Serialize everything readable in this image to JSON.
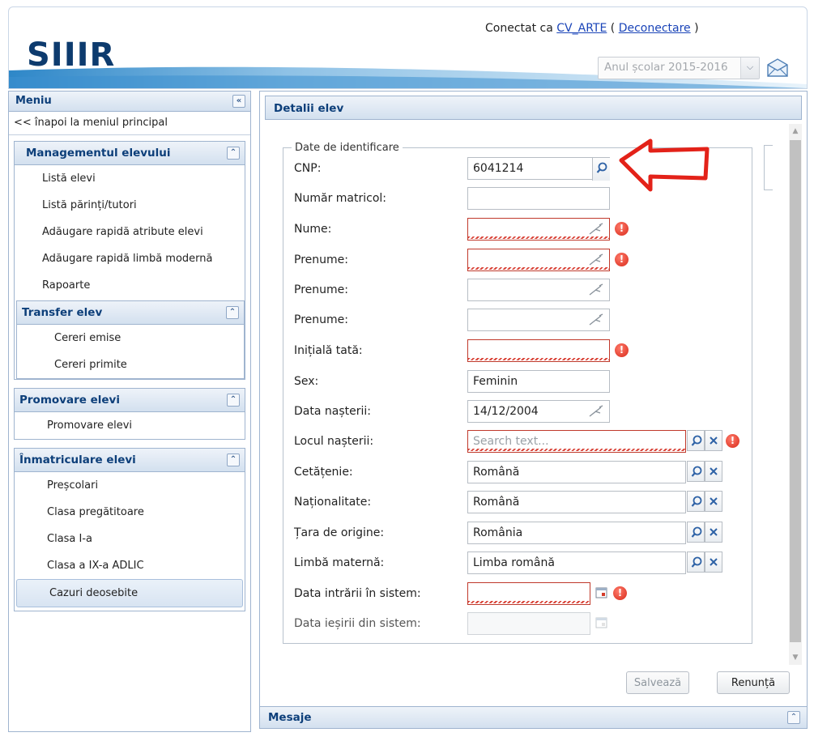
{
  "header": {
    "logo": "SIIIR",
    "connected_prefix": "Conectat ca ",
    "username": "CV_ARTE",
    "paren_open": " ( ",
    "logout": "Deconectare",
    "paren_close": " )",
    "school_year": "Anul școlar 2015-2016"
  },
  "menu": {
    "title": "Meniu",
    "back_link": "<< înapoi la meniul principal",
    "group_title": "Managementul elevului",
    "items": [
      "Listă elevi",
      "Listă părinți/tutori",
      "Adăugare rapidă atribute elevi",
      "Adăugare rapidă limbă modernă",
      "Rapoarte"
    ],
    "transfer": {
      "title": "Transfer elev",
      "items": [
        "Cereri emise",
        "Cereri primite"
      ]
    },
    "promovare": {
      "title": "Promovare elevi",
      "items": [
        "Promovare elevi"
      ]
    },
    "inmatriculare": {
      "title": "Înmatriculare elevi",
      "items": [
        "Preșcolari",
        "Clasa pregătitoare",
        "Clasa I-a",
        "Clasa a IX-a ADLIC",
        "Cazuri deosebite"
      ]
    }
  },
  "main": {
    "title": "Detalii elev",
    "fieldset_legend": "Date de identificare",
    "labels": {
      "cnp": "CNP:",
      "nr_matricol": "Număr matricol:",
      "nume": "Nume:",
      "prenume1": "Prenume:",
      "prenume2": "Prenume:",
      "prenume3": "Prenume:",
      "initiala": "Inițială tată:",
      "sex": "Sex:",
      "data_nasterii": "Data nașterii:",
      "locul_nasterii": "Locul nașterii:",
      "cetatenie": "Cetățenie:",
      "nationalitate": "Naționalitate:",
      "tara": "Țara de origine:",
      "limba": "Limbă maternă:",
      "data_intrarii": "Data intrării în sistem:",
      "data_iesirii": "Data ieșirii din sistem:"
    },
    "values": {
      "cnp": "6041214",
      "sex": "Feminin",
      "data_nasterii": "14/12/2004",
      "locul_nasterii_placeholder": "Search text...",
      "cetatenie": "Română",
      "nationalitate": "Română",
      "tara": "România",
      "limba": "Limba română"
    },
    "buttons": {
      "save": "Salvează",
      "cancel": "Renunță"
    }
  },
  "messages": {
    "title": "Mesaje"
  },
  "colors": {
    "error": "#d82a1a",
    "accent": "#0d3f7a",
    "arrow": "#e32219"
  }
}
